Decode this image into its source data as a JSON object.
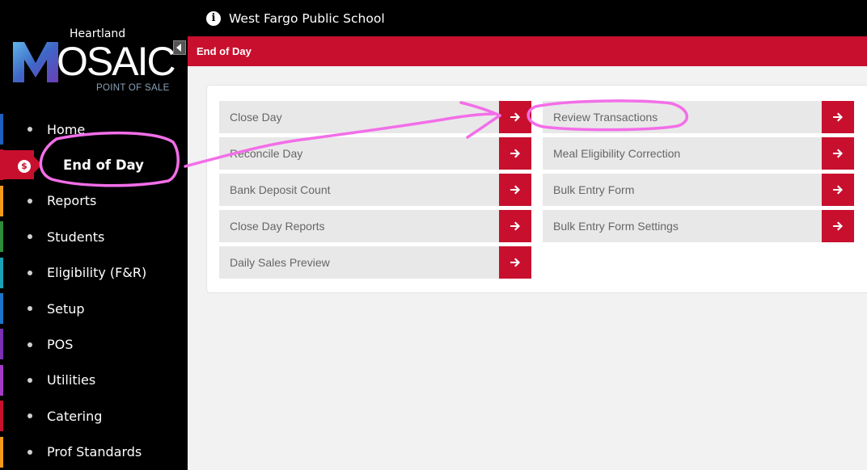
{
  "brand": {
    "top": "Heartland",
    "mark": "OSAIC",
    "tagline": "POINT OF SALE"
  },
  "header": {
    "school": "West Fargo Public School",
    "info_icon": "info-icon"
  },
  "subheader": {
    "title": "End of Day"
  },
  "nav": {
    "items": [
      {
        "label": "Home",
        "color": "#1f5fbf"
      },
      {
        "label": "End of Day",
        "color": "#c8102e",
        "active": true
      },
      {
        "label": "Reports",
        "color": "#f29b1b"
      },
      {
        "label": "Students",
        "color": "#2e8b3a"
      },
      {
        "label": "Eligibility (F&R)",
        "color": "#1aa3b8"
      },
      {
        "label": "Setup",
        "color": "#1b75c9"
      },
      {
        "label": "POS",
        "color": "#7b2fb3"
      },
      {
        "label": "Utilities",
        "color": "#a23cc4"
      },
      {
        "label": "Catering",
        "color": "#c8102e"
      },
      {
        "label": "Prof Standards",
        "color": "#f29b1b"
      }
    ]
  },
  "actions": {
    "left": [
      "Close Day",
      "Reconcile Day",
      "Bank Deposit Count",
      "Close Day Reports",
      "Daily Sales Preview"
    ],
    "right": [
      "Review Transactions",
      "Meal Eligibility Correction",
      "Bulk Entry Form",
      "Bulk Entry Form Settings"
    ]
  },
  "colors": {
    "accent": "#c8102e",
    "annotation": "#f36ee8"
  }
}
